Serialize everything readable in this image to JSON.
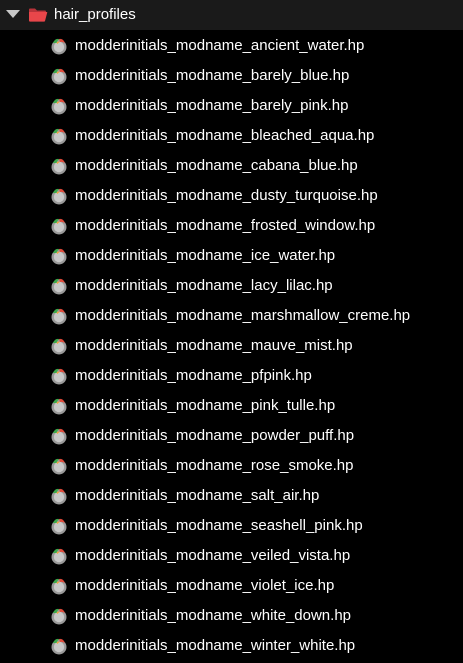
{
  "folder": {
    "icon": "folder-open-icon",
    "name": "hair_profiles",
    "expanded": true,
    "color": "#e8464a"
  },
  "file_icon": "hair-profile-file-icon",
  "files": [
    {
      "name": "modderinitials_modname_ancient_water.hp"
    },
    {
      "name": "modderinitials_modname_barely_blue.hp"
    },
    {
      "name": "modderinitials_modname_barely_pink.hp"
    },
    {
      "name": "modderinitials_modname_bleached_aqua.hp"
    },
    {
      "name": "modderinitials_modname_cabana_blue.hp"
    },
    {
      "name": "modderinitials_modname_dusty_turquoise.hp"
    },
    {
      "name": "modderinitials_modname_frosted_window.hp"
    },
    {
      "name": "modderinitials_modname_ice_water.hp"
    },
    {
      "name": "modderinitials_modname_lacy_lilac.hp"
    },
    {
      "name": "modderinitials_modname_marshmallow_creme.hp"
    },
    {
      "name": "modderinitials_modname_mauve_mist.hp"
    },
    {
      "name": "modderinitials_modname_pfpink.hp"
    },
    {
      "name": "modderinitials_modname_pink_tulle.hp"
    },
    {
      "name": "modderinitials_modname_powder_puff.hp"
    },
    {
      "name": "modderinitials_modname_rose_smoke.hp"
    },
    {
      "name": "modderinitials_modname_salt_air.hp"
    },
    {
      "name": "modderinitials_modname_seashell_pink.hp"
    },
    {
      "name": "modderinitials_modname_veiled_vista.hp"
    },
    {
      "name": "modderinitials_modname_violet_ice.hp"
    },
    {
      "name": "modderinitials_modname_white_down.hp"
    },
    {
      "name": "modderinitials_modname_winter_white.hp"
    }
  ]
}
